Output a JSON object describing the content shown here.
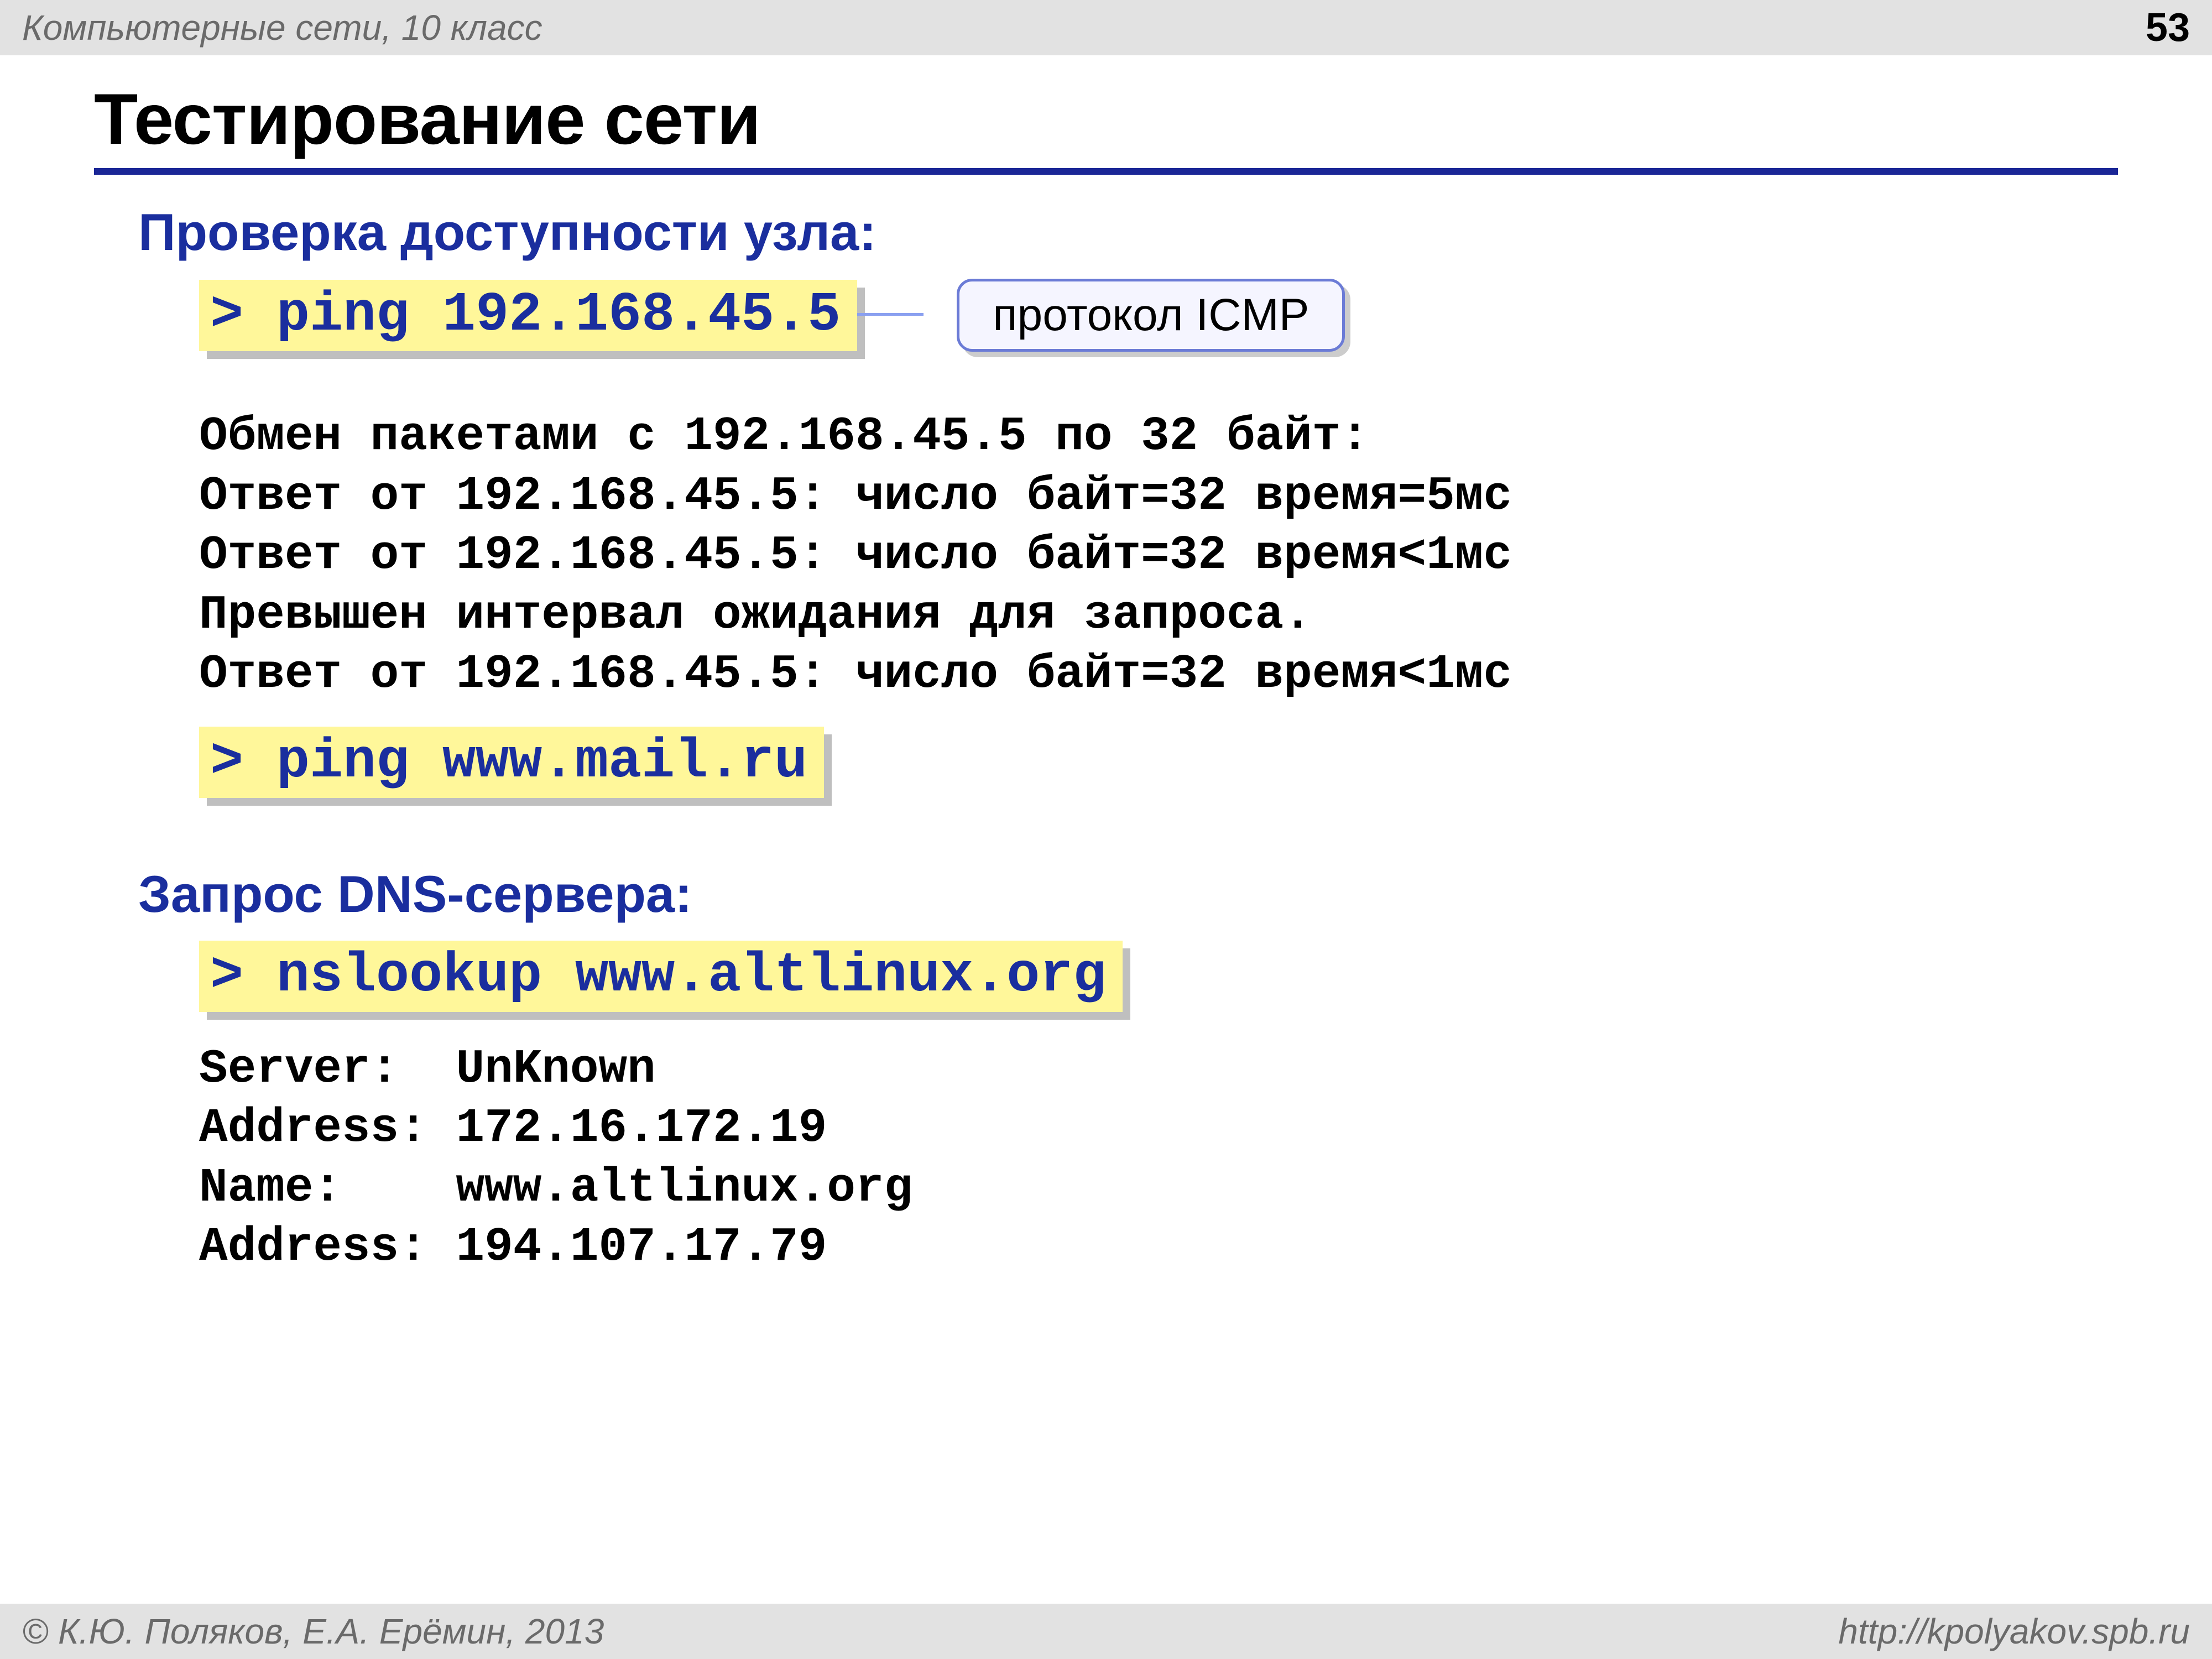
{
  "header": {
    "course": "Компьютерные сети, 10 класс",
    "page_number": "53"
  },
  "title": "Тестирование сети",
  "section1": {
    "heading": "Проверка доступности узла:",
    "cmd1_prompt": ">",
    "cmd1_text": " ping 192.168.45.5",
    "callout": "протокол ICMP",
    "output": "Обмен пакетами с 192.168.45.5 по 32 байт:\nОтвет от 192.168.45.5: число байт=32 время=5мс\nОтвет от 192.168.45.5: число байт=32 время<1мс\nПревышен интервал ожидания для запроса.\nОтвет от 192.168.45.5: число байт=32 время<1мс",
    "cmd2_prompt": ">",
    "cmd2_text": " ping www.mail.ru"
  },
  "section2": {
    "heading": "Запрос DNS-сервера:",
    "cmd_prompt": ">",
    "cmd_text": " nslookup www.altlinux.org",
    "output": "Server:  UnKnown\nAddress: 172.16.172.19\nName:    www.altlinux.org\nAddress: 194.107.17.79"
  },
  "footer": {
    "copyright": "© К.Ю. Поляков, Е.А. Ерёмин, 2013",
    "url": "http://kpolyakov.spb.ru"
  }
}
